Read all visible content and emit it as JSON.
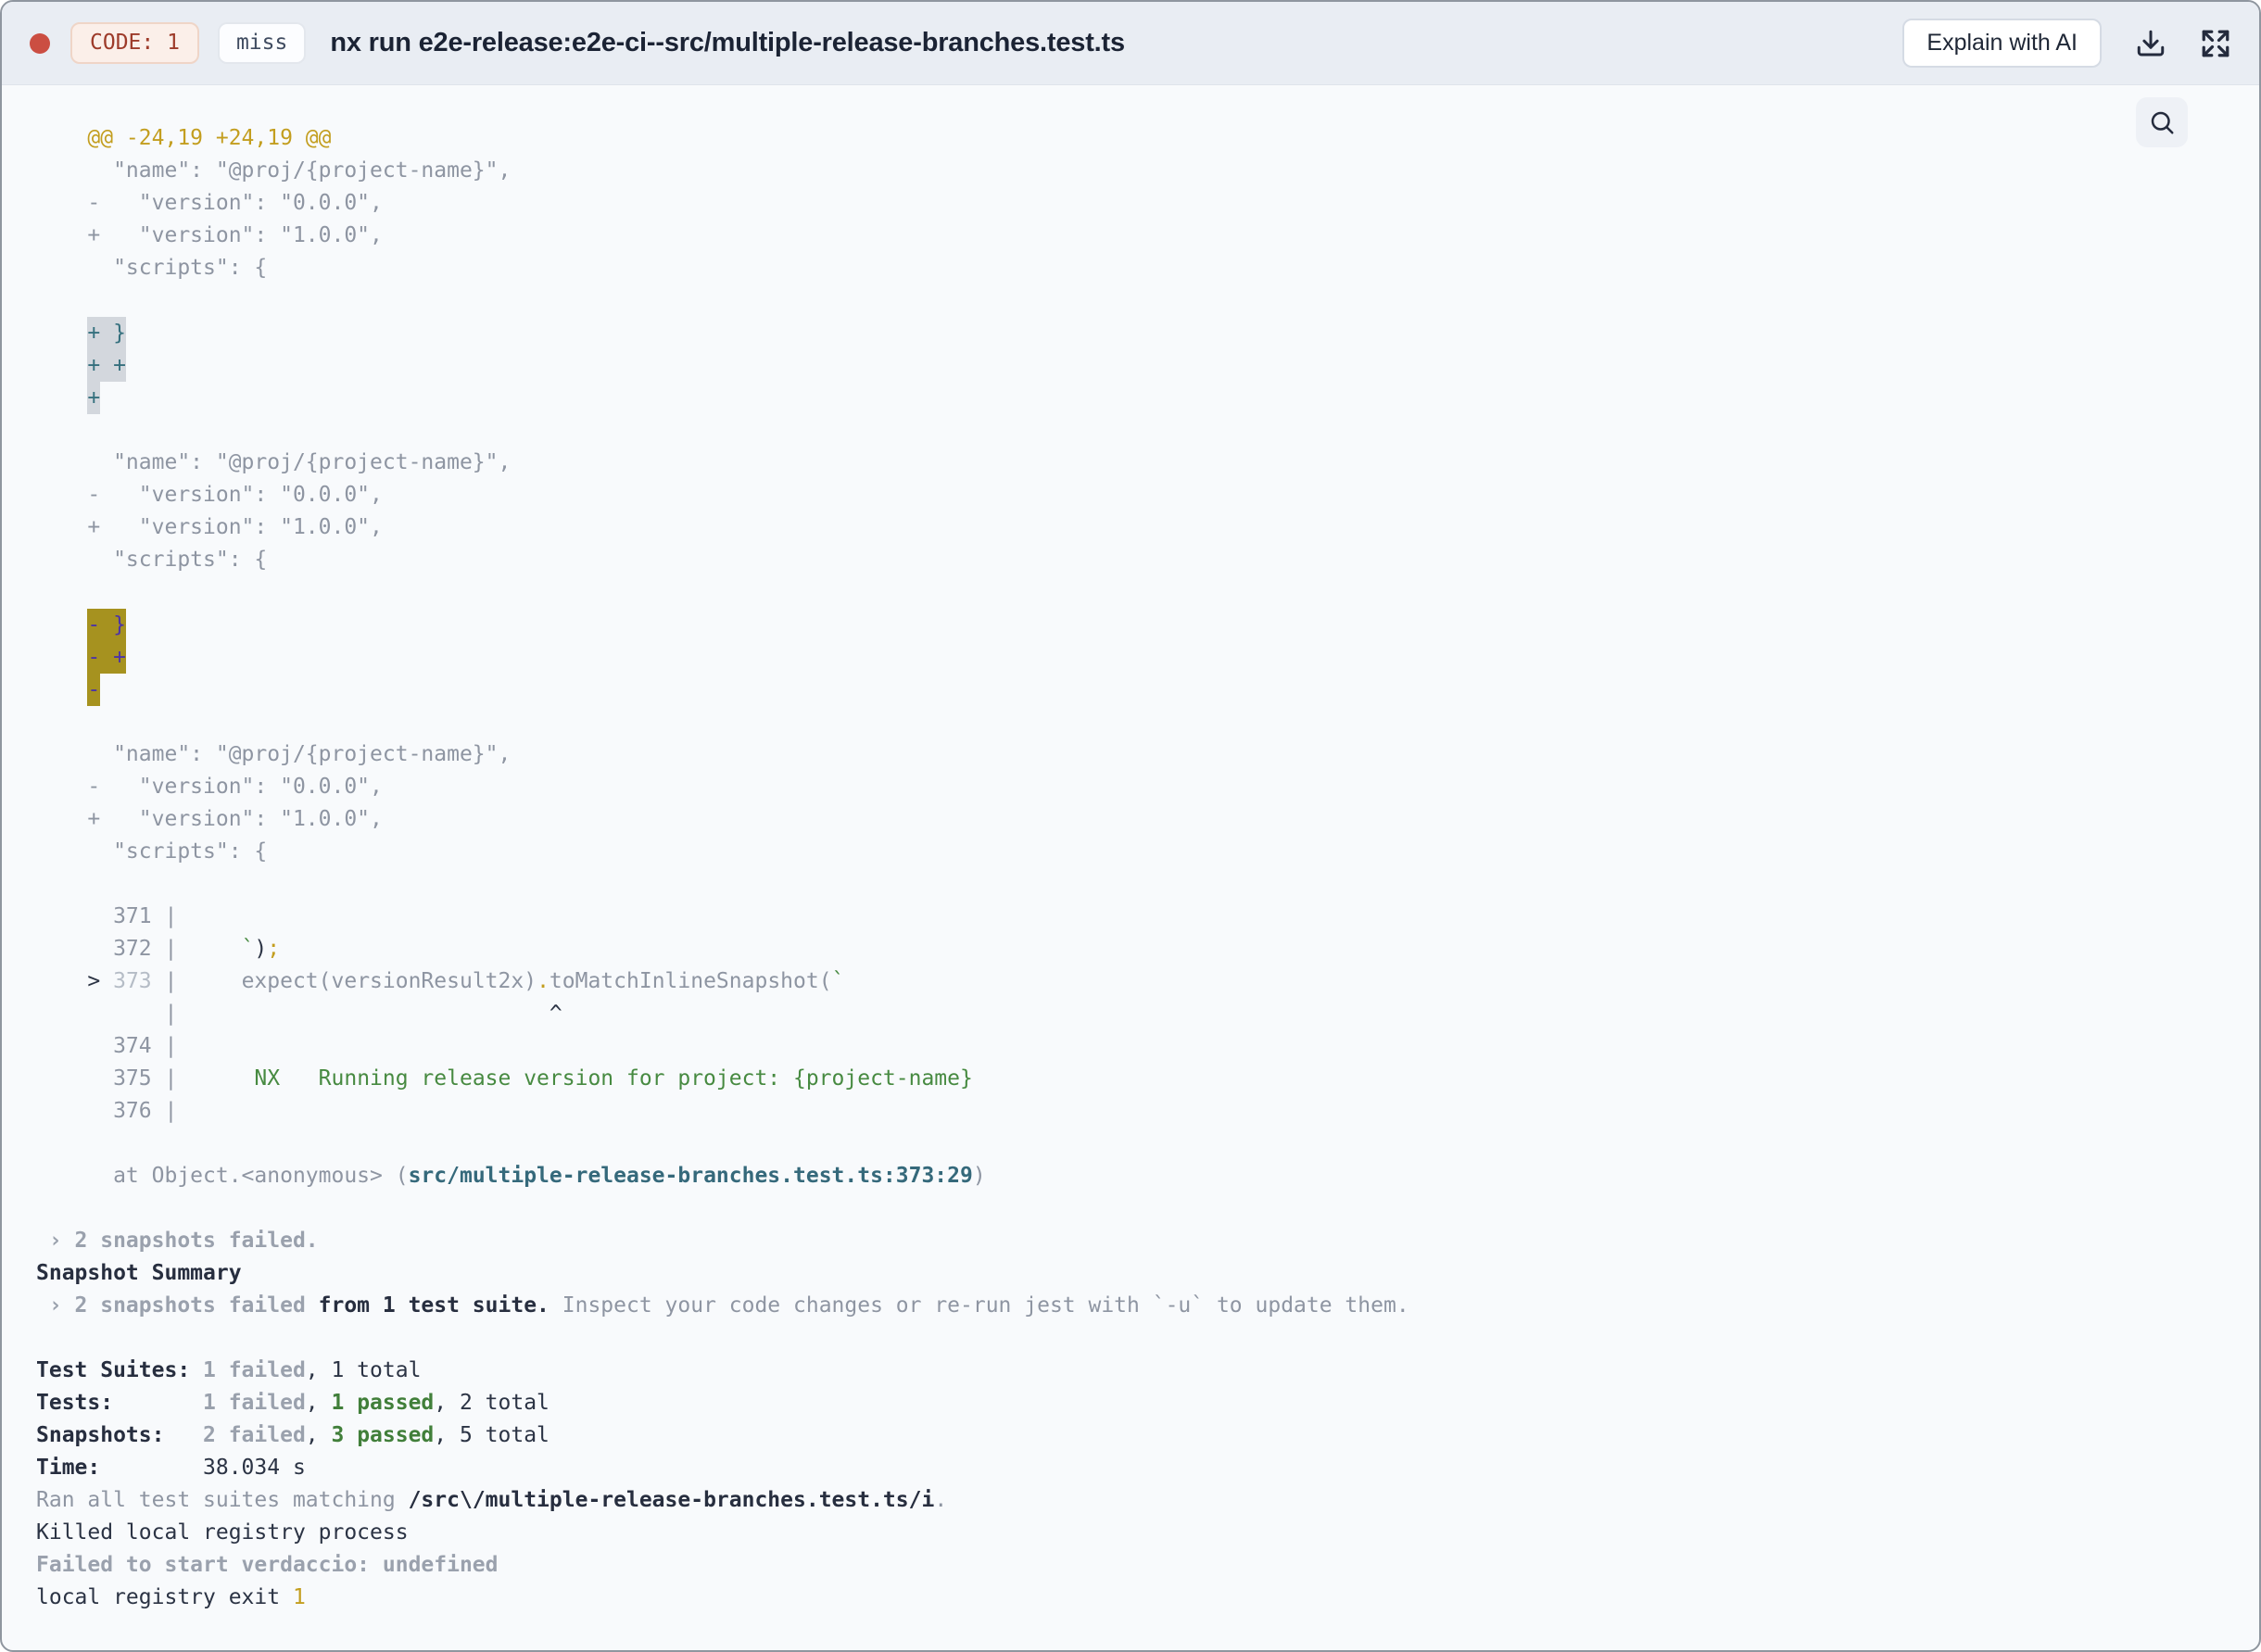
{
  "header": {
    "code_badge": "CODE: 1",
    "cache_badge": "miss",
    "title": "nx run e2e-release:e2e-ci--src/multiple-release-branches.test.ts",
    "explain_button": "Explain with AI",
    "icons": {
      "status_dot": "red-circle",
      "download": "download-tray-arrow",
      "expand": "fullscreen-arrows"
    }
  },
  "palette": {
    "status_dot": "#cb4e42",
    "code_badge_text": "#9d3b2a",
    "header_bg": "#e9edf3",
    "terminal_bg": "#f8fafc",
    "diff_yellow": "#c39e1f",
    "pass_green": "#417f3a",
    "path_teal": "#35697b",
    "added_highlight_bg": "#d3d7dd",
    "removed_highlight_bg": "#a6921f",
    "removed_highlight_text": "#4c33a6"
  },
  "terminal": {
    "search_icon": "magnifier",
    "lines": [
      [
        {
          "c": "y",
          "t": "    @@ -24,19 +24,19 @@"
        }
      ],
      [
        {
          "c": "g",
          "t": "      \"name\": \"@proj/{project-name}\","
        }
      ],
      [
        {
          "c": "g",
          "t": "    -   \"version\": \"0.0.0\","
        }
      ],
      [
        {
          "c": "g",
          "t": "    +   \"version\": \"1.0.0\","
        }
      ],
      [
        {
          "c": "g",
          "t": "      \"scripts\": {"
        }
      ],
      [],
      [
        {
          "t": "    "
        },
        {
          "c": "hg",
          "t": "+ }"
        }
      ],
      [
        {
          "t": "    "
        },
        {
          "c": "hg",
          "t": "+ +"
        }
      ],
      [
        {
          "t": "    "
        },
        {
          "c": "hg",
          "t": "+"
        }
      ],
      [],
      [
        {
          "c": "g",
          "t": "      \"name\": \"@proj/{project-name}\","
        }
      ],
      [
        {
          "c": "g",
          "t": "    -   \"version\": \"0.0.0\","
        }
      ],
      [
        {
          "c": "g",
          "t": "    +   \"version\": \"1.0.0\","
        }
      ],
      [
        {
          "c": "g",
          "t": "      \"scripts\": {"
        }
      ],
      [],
      [
        {
          "t": "    "
        },
        {
          "c": "hy",
          "t": "- }"
        }
      ],
      [
        {
          "t": "    "
        },
        {
          "c": "hy",
          "t": "- +"
        }
      ],
      [
        {
          "t": "    "
        },
        {
          "c": "hy",
          "t": "-"
        }
      ],
      [],
      [
        {
          "c": "g",
          "t": "      \"name\": \"@proj/{project-name}\","
        }
      ],
      [
        {
          "c": "g",
          "t": "    -   \"version\": \"0.0.0\","
        }
      ],
      [
        {
          "c": "g",
          "t": "    +   \"version\": \"1.0.0\","
        }
      ],
      [
        {
          "c": "g",
          "t": "      \"scripts\": {"
        }
      ],
      [],
      [
        {
          "c": "g",
          "t": "      371 |"
        }
      ],
      [
        {
          "c": "g",
          "t": "      372 |     "
        },
        {
          "c": "gr",
          "t": "`"
        },
        {
          "c": "d",
          "t": ")"
        },
        {
          "c": "y",
          "t": ";"
        }
      ],
      [
        {
          "c": "d",
          "t": "    > "
        },
        {
          "c": "dn",
          "t": "373 "
        },
        {
          "c": "g",
          "t": "|     expect(versionResult2x)"
        },
        {
          "c": "y",
          "t": "."
        },
        {
          "c": "g",
          "t": "toMatchInlineSnapshot("
        },
        {
          "c": "gr",
          "t": "`"
        }
      ],
      [
        {
          "c": "g",
          "t": "          |"
        },
        {
          "c": "d",
          "t": "                             ^"
        }
      ],
      [
        {
          "c": "g",
          "t": "      374 |"
        }
      ],
      [
        {
          "c": "g",
          "t": "      375 |"
        },
        {
          "c": "gr",
          "t": "      NX   Running release version for project: {project-name}"
        }
      ],
      [
        {
          "c": "g",
          "t": "      376 |"
        }
      ],
      [],
      [
        {
          "c": "g",
          "t": "      at Object.<anonymous> ("
        },
        {
          "c": "tb",
          "t": "src/multiple-release-branches.test.ts:373:29"
        },
        {
          "c": "g",
          "t": ")"
        }
      ],
      [],
      [
        {
          "c": "bg",
          "t": " › 2 snapshots failed."
        }
      ],
      [
        {
          "c": "bd",
          "t": "Snapshot Summary"
        }
      ],
      [
        {
          "c": "bg",
          "t": " › 2 snapshots failed"
        },
        {
          "c": "bd",
          "t": " from 1 test suite."
        },
        {
          "c": "g",
          "t": " Inspect your code changes or re-run jest with `-u` to update them."
        }
      ],
      [],
      [
        {
          "c": "bd",
          "t": "Test Suites: "
        },
        {
          "c": "bg",
          "t": "1 failed"
        },
        {
          "c": "d",
          "t": ", 1 total"
        }
      ],
      [
        {
          "c": "bd",
          "t": "Tests:       "
        },
        {
          "c": "bg",
          "t": "1 failed"
        },
        {
          "c": "d",
          "t": ", "
        },
        {
          "c": "bgr",
          "t": "1 passed"
        },
        {
          "c": "d",
          "t": ", 2 total"
        }
      ],
      [
        {
          "c": "bd",
          "t": "Snapshots:   "
        },
        {
          "c": "bg",
          "t": "2 failed"
        },
        {
          "c": "d",
          "t": ", "
        },
        {
          "c": "bgr",
          "t": "3 passed"
        },
        {
          "c": "d",
          "t": ", 5 total"
        }
      ],
      [
        {
          "c": "bd",
          "t": "Time:        "
        },
        {
          "c": "d",
          "t": "38.034 s"
        }
      ],
      [
        {
          "c": "g",
          "t": "Ran all test suites matching "
        },
        {
          "c": "bd",
          "t": "/src\\/multiple-release-branches.test.ts/i"
        },
        {
          "c": "g",
          "t": "."
        }
      ],
      [
        {
          "c": "d",
          "t": "Killed local registry process"
        }
      ],
      [
        {
          "c": "bg",
          "t": "Failed to start verdaccio: undefined"
        }
      ],
      [
        {
          "c": "d",
          "t": "local registry exit "
        },
        {
          "c": "y",
          "t": "1"
        }
      ]
    ]
  }
}
